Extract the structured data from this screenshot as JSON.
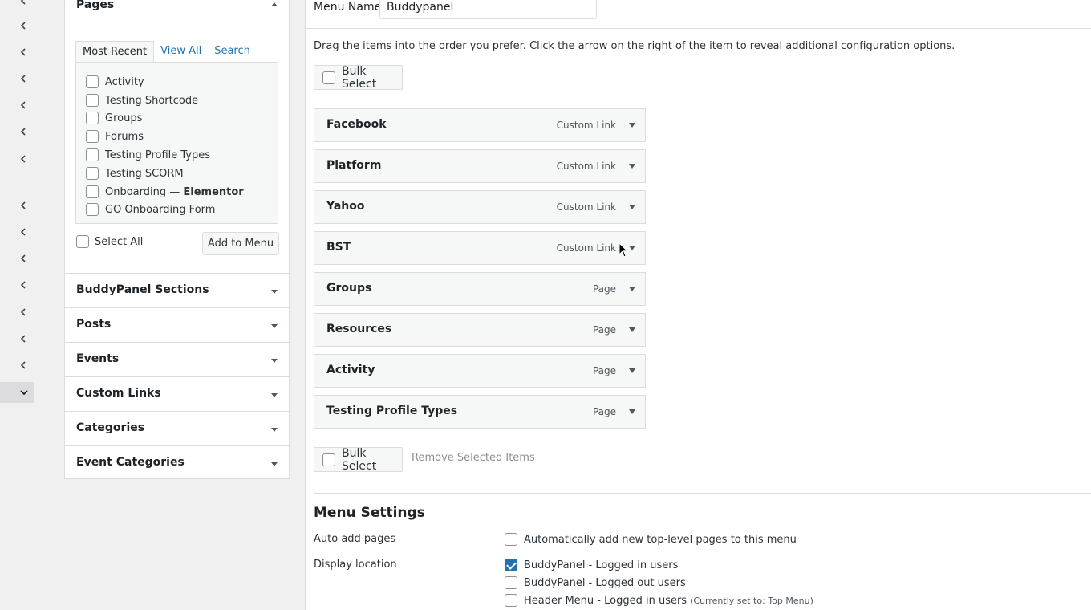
{
  "rail": {
    "icon": "chevron-left-icon",
    "active_icon": "chevron-down-icon"
  },
  "pages_panel": {
    "title": "Pages",
    "tabs": [
      "Most Recent",
      "View All",
      "Search"
    ],
    "items": [
      {
        "label": "Activity"
      },
      {
        "label": "Testing Shortcode"
      },
      {
        "label": "Groups"
      },
      {
        "label": "Forums"
      },
      {
        "label": "Testing Profile Types"
      },
      {
        "label": "Testing SCORM"
      },
      {
        "label": "Onboarding — ",
        "bold": "Elementor"
      },
      {
        "label": "GO Onboarding Form"
      }
    ],
    "select_all": "Select All",
    "add_to_menu": "Add to Menu"
  },
  "accordions": [
    "BuddyPanel Sections",
    "Posts",
    "Events",
    "Custom Links",
    "Categories",
    "Event Categories"
  ],
  "menu": {
    "name_label": "Menu Name",
    "name_value": "Buddypanel",
    "instructions": "Drag the items into the order you prefer. Click the arrow on the right of the item to reveal additional configuration options.",
    "bulk_select": "Bulk Select",
    "remove_selected": "Remove Selected Items",
    "items": [
      {
        "title": "Facebook",
        "type": "Custom Link"
      },
      {
        "title": "Platform",
        "type": "Custom Link"
      },
      {
        "title": "Yahoo",
        "type": "Custom Link"
      },
      {
        "title": "BST",
        "type": "Custom Link"
      },
      {
        "title": "Groups",
        "type": "Page"
      },
      {
        "title": "Resources",
        "type": "Page"
      },
      {
        "title": "Activity",
        "type": "Page"
      },
      {
        "title": "Testing Profile Types",
        "type": "Page"
      }
    ]
  },
  "settings": {
    "title": "Menu Settings",
    "auto_add_label": "Auto add pages",
    "auto_add_option": "Automatically add new top-level pages to this menu",
    "display_label": "Display location",
    "locations": [
      {
        "label": "BuddyPanel - Logged in users",
        "checked": true
      },
      {
        "label": "BuddyPanel - Logged out users",
        "checked": false
      },
      {
        "label": "Header Menu - Logged in users",
        "note": "(Currently set to: Top Menu)",
        "checked": false
      }
    ]
  },
  "colors": {
    "accent": "#2271b1",
    "border": "#dcdcde",
    "panel_bg": "#f6f7f7"
  }
}
